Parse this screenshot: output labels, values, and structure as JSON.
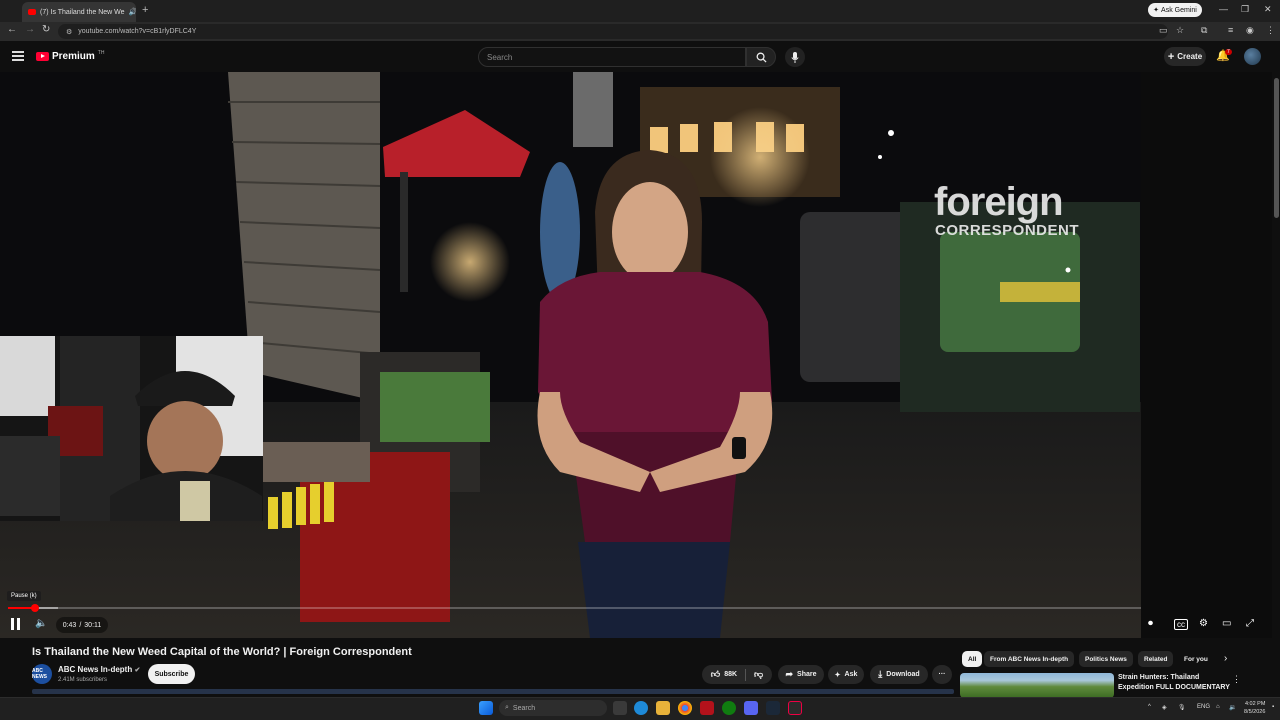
{
  "browser": {
    "tab_title": "(7) Is Thailand the New We",
    "new_tab_glyph": "+",
    "ask_gemini": "Ask Gemini",
    "url": "youtube.com/watch?v=cB1rlyDFLC4Y"
  },
  "youtube": {
    "brand": "Premium",
    "brand_region": "TH",
    "search_placeholder": "Search",
    "create_label": "Create",
    "notifications_count": "7"
  },
  "video": {
    "watermark_line1": "foreign",
    "watermark_line2": "CORRESPONDENT",
    "tooltip": "Pause (k)",
    "current_time": "0:43",
    "duration": "30:11",
    "progress_fraction": 0.024,
    "title": "Is Thailand the New Weed Capital of the World? | Foreign Correspondent"
  },
  "channel": {
    "name": "ABC News In-depth",
    "avatar_text": "ABC NEWS",
    "subscribers": "2.41M subscribers",
    "subscribe_label": "Subscribe"
  },
  "actions": {
    "likes": "88K",
    "share": "Share",
    "ask": "Ask",
    "download": "Download",
    "more": "···"
  },
  "recommendations": {
    "chips": [
      "All",
      "From ABC News In-depth",
      "Politics News",
      "Related",
      "For you"
    ],
    "first_title": "Strain Hunters: Thailand Expedition FULL DOCUMENTARY"
  },
  "taskbar": {
    "search_placeholder": "Search",
    "language": "ENG",
    "time": "4:02 PM",
    "date": "8/5/2026"
  },
  "colors": {
    "accent": "#ff0000",
    "background": "#0f0f0f",
    "chip_active": "#f1f1f1"
  }
}
